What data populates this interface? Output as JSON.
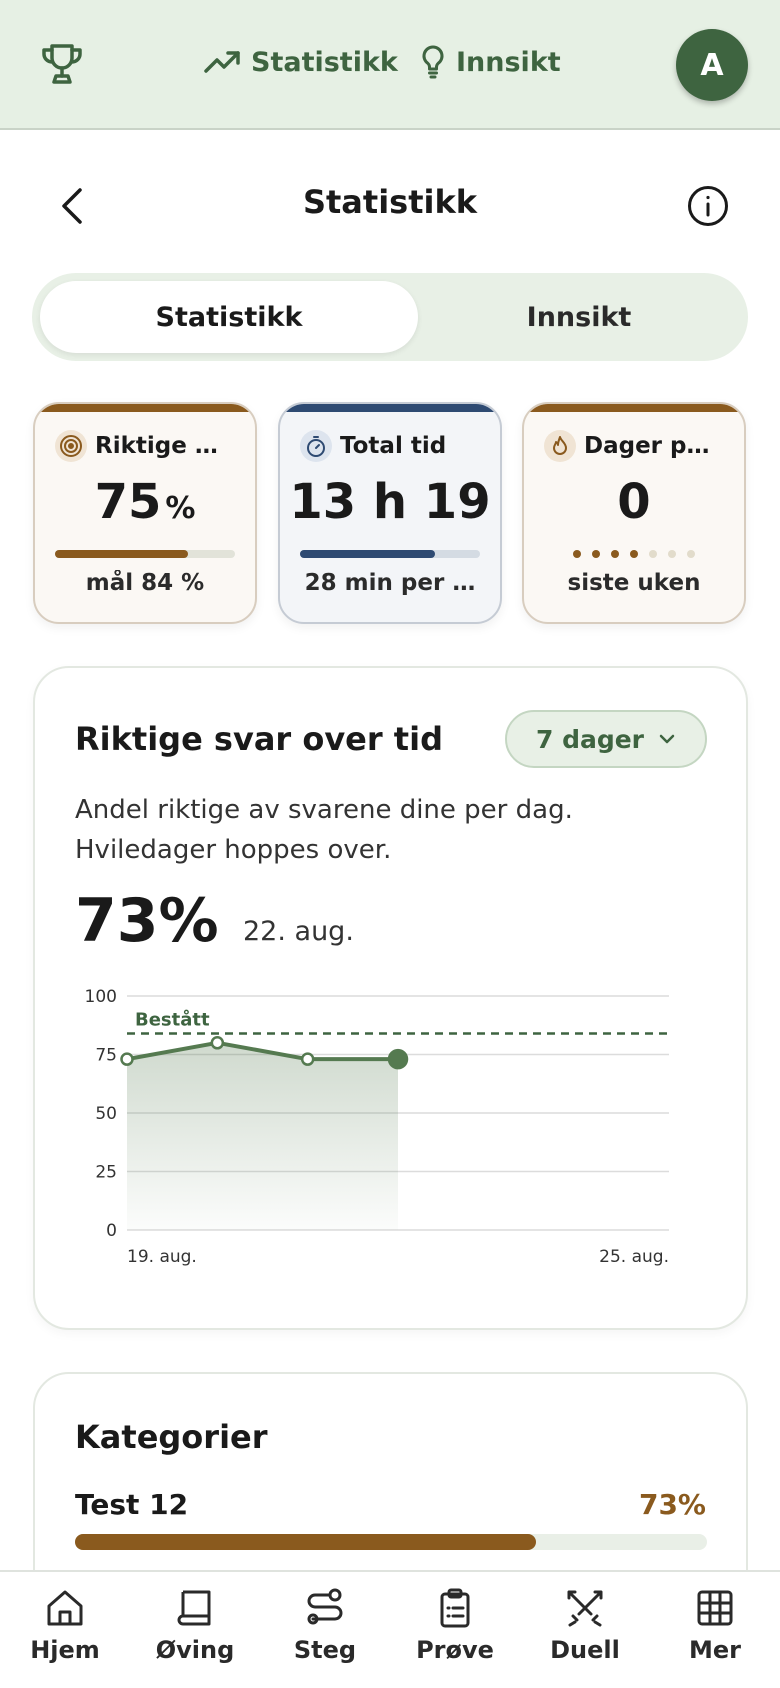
{
  "appbar": {
    "nav": [
      {
        "label": "Statistikk",
        "icon": "trending-up-icon"
      },
      {
        "label": "Innsikt",
        "icon": "lightbulb-icon"
      }
    ],
    "avatar_initial": "A"
  },
  "header": {
    "title": "Statistikk"
  },
  "segment": {
    "tabs": [
      "Statistikk",
      "Innsikt"
    ],
    "selected": "Statistikk"
  },
  "stats": [
    {
      "title": "Riktige …",
      "value": "75",
      "unit": "%",
      "progress": 0.74,
      "sub": "mål 84 %",
      "icon": "target-icon"
    },
    {
      "title": "Total tid",
      "value": "13 h 19",
      "unit": "",
      "progress": 0.75,
      "sub": "28 min per …",
      "icon": "stopwatch-icon"
    },
    {
      "title": "Dager p…",
      "value": "0",
      "unit": "",
      "streak_days_filled": 4,
      "streak_days_total": 7,
      "sub": "siste uken",
      "icon": "flame-icon"
    }
  ],
  "chart_card": {
    "title": "Riktige svar over tid",
    "range": "7 dager",
    "description": "Andel riktige av svarene dine per dag. Hviledager hoppes over.",
    "highlight_value": "73%",
    "highlight_date": "22. aug."
  },
  "chart_data": {
    "type": "line",
    "x": [
      "19. aug.",
      "20. aug.",
      "21. aug.",
      "22. aug."
    ],
    "values": [
      73,
      80,
      73,
      73
    ],
    "x_tick_labels": [
      "19. aug.",
      "25. aug."
    ],
    "y_ticks": [
      0,
      25,
      50,
      75,
      100
    ],
    "ylim": [
      0,
      100
    ],
    "x_range_days": 7,
    "reference_line": {
      "label": "Bestått",
      "value": 84
    },
    "grid": true,
    "colors": {
      "line": "#557a50",
      "reference": "#3e6440"
    }
  },
  "categories": {
    "title": "Kategorier",
    "items": [
      {
        "label": "Test 12",
        "pct_label": "73%",
        "value": 0.73
      }
    ]
  },
  "bottom_nav": [
    {
      "label": "Hjem",
      "icon": "home-icon"
    },
    {
      "label": "Øving",
      "icon": "book-icon"
    },
    {
      "label": "Steg",
      "icon": "route-icon"
    },
    {
      "label": "Prøve",
      "icon": "clipboard-icon"
    },
    {
      "label": "Duell",
      "icon": "swords-icon"
    },
    {
      "label": "Mer",
      "icon": "grid-icon"
    }
  ],
  "colors": {
    "accent": "#3e6440",
    "brown": "#8a5a1e",
    "navy": "#2e4a72"
  }
}
